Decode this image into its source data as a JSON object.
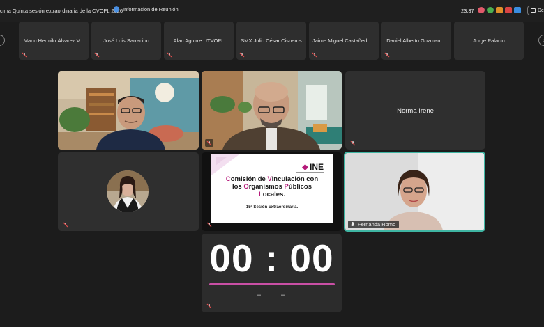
{
  "topbar": {
    "meeting_title": "cima Quinta sesión extraordinaria de la CVOPL 2026",
    "info_label": "Información de Reunión",
    "clock": "23:37",
    "right_button_label": "De"
  },
  "participants_strip": [
    {
      "name": "Mario Hermilo Álvarez V..."
    },
    {
      "name": "José Luis Sarracino"
    },
    {
      "name": "Alan Aguirre UTVOPL"
    },
    {
      "name": "SMX Julio César Cisneros"
    },
    {
      "name": "Jaime Miguel Castañeda ..."
    },
    {
      "name": "Daniel Alberto Guzman ..."
    },
    {
      "name": "Jorge Palacio"
    }
  ],
  "grid": {
    "norma_name": "Norma Irene",
    "fernanda_name": "Fernanda Romo"
  },
  "slide": {
    "logo": "INE",
    "title_line1_a": "C",
    "title_line1_b": "omisión de ",
    "title_line1_c": "V",
    "title_line1_d": "inculación con",
    "title_line2_a": "los ",
    "title_line2_b": "O",
    "title_line2_c": "rganismos ",
    "title_line2_d": "P",
    "title_line2_e": "úblicos",
    "title_line3_a": "L",
    "title_line3_b": "ocales.",
    "subtitle": "15ª Sesión Extraordinaria."
  },
  "timer": {
    "display": "00 : 00"
  },
  "colors": {
    "active_border": "#3fb5a3",
    "timer_bar": "#c94fa5",
    "slide_accent": "#b5197a",
    "mic_off": "#e04e4e"
  }
}
